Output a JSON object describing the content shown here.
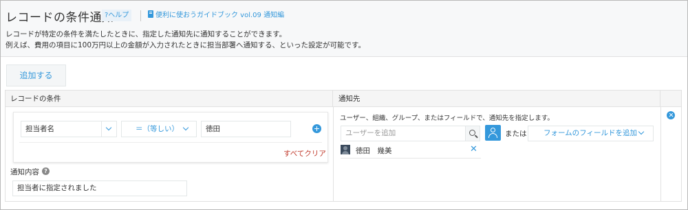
{
  "header": {
    "title": "レコードの条件通知",
    "help_link": "?ヘルプ",
    "guide_link": "便利に使おうガイドブック vol.09 通知編",
    "description_line1": "レコードが特定の条件を満たしたときに、指定した通知先に通知することができます。",
    "description_line2": "例えば、費用の項目に100万円以上の金額が入力されたときに担当部署へ通知する、といった設定が可能です。"
  },
  "toolbar": {
    "add_label": "追加する"
  },
  "table": {
    "columns": [
      "レコードの条件",
      "通知先",
      ""
    ]
  },
  "condition": {
    "field": "担当者名",
    "operator": "＝（等しい）",
    "value": "徳田",
    "clear_all": "すべてクリア",
    "notify_label": "通知内容",
    "notify_text": "担当者に指定されました"
  },
  "destination": {
    "description": "ユーザー、組織、グループ、またはフィールドで、通知先を指定します。",
    "user_input_placeholder": "ユーザーを追加",
    "or_text": "または",
    "field_add_label": "フォームのフィールドを追加",
    "users": [
      {
        "name": "徳田　幾美"
      }
    ]
  },
  "colors": {
    "accent": "#3498db",
    "danger": "#c0392b",
    "header_bg": "#f7f8f9",
    "border": "#e1e1e1"
  },
  "icons": {
    "help": "question-icon",
    "guide": "book-icon",
    "search": "search-icon",
    "org": "user-org-icon",
    "add": "plus-circle-icon",
    "remove_user": "close-icon",
    "remove_row": "close-circle-icon"
  }
}
